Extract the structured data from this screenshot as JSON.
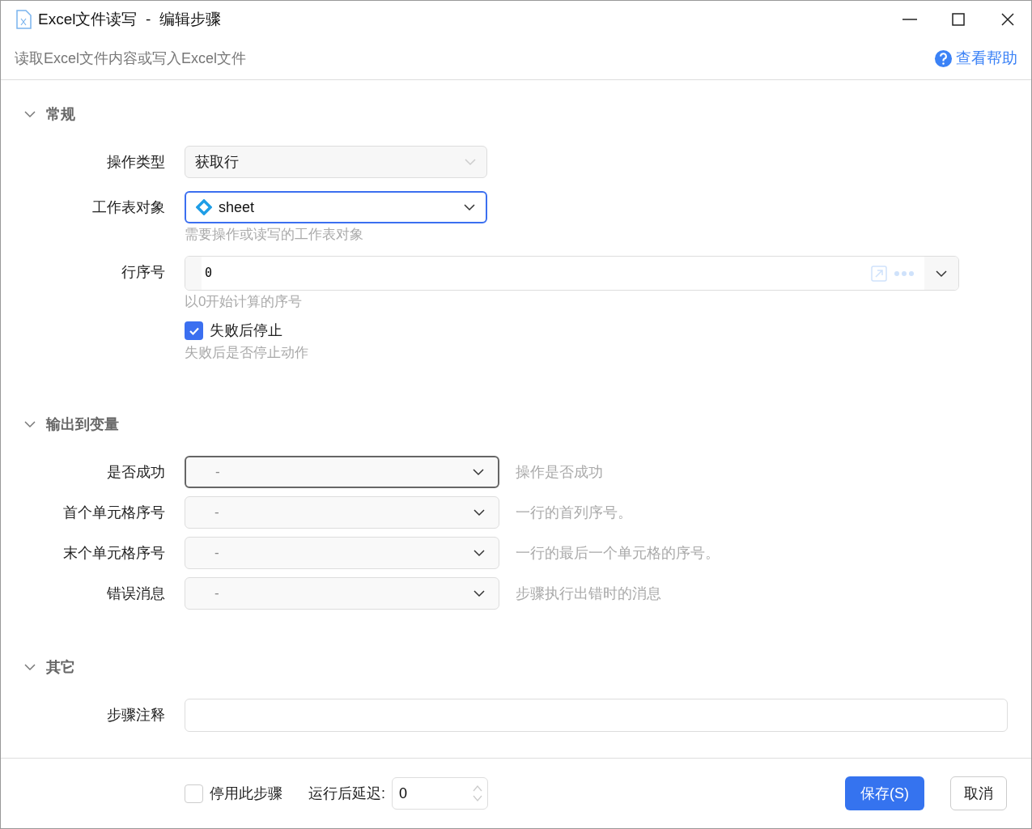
{
  "window": {
    "title": "Excel文件读写  -  编辑步骤",
    "subtitle": "读取Excel文件内容或写入Excel文件",
    "help_link": "查看帮助"
  },
  "sections": [
    {
      "title": "常规",
      "expanded": true,
      "fields": [
        {
          "kind": "select",
          "label": "操作类型",
          "value": "获取行",
          "disabled": true,
          "focused": false
        },
        {
          "kind": "select",
          "label": "工作表对象",
          "value": "sheet",
          "disabled": false,
          "focused": true,
          "hint": "需要操作或读写的工作表对象"
        },
        {
          "kind": "expression",
          "label": "行序号",
          "value": "0",
          "hint": "以0开始计算的序号"
        },
        {
          "kind": "checkbox",
          "label": "失败后停止",
          "checked": true,
          "hint": "失败后是否停止动作"
        }
      ]
    },
    {
      "title": "输出到变量",
      "expanded": true,
      "fields": [
        {
          "kind": "output",
          "label": "是否成功",
          "value": "-",
          "focused": true,
          "description": "操作是否成功"
        },
        {
          "kind": "output",
          "label": "首个单元格序号",
          "value": "-",
          "focused": false,
          "description": "一行的首列序号。"
        },
        {
          "kind": "output",
          "label": "末个单元格序号",
          "value": "-",
          "focused": false,
          "description": "一行的最后一个单元格的序号。"
        },
        {
          "kind": "output",
          "label": "错误消息",
          "value": "-",
          "focused": false,
          "description": "步骤执行出错时的消息"
        }
      ]
    },
    {
      "title": "其它",
      "expanded": true,
      "fields": [
        {
          "kind": "text",
          "label": "步骤注释"
        }
      ]
    }
  ],
  "footer": {
    "disable_step": {
      "label": "停用此步骤",
      "checked": false
    },
    "delay": {
      "label": "运行后延迟:",
      "value": "0"
    },
    "buttons": [
      {
        "label": "保存(S)",
        "kind": "primary"
      },
      {
        "label": "取消",
        "kind": "default"
      }
    ]
  }
}
